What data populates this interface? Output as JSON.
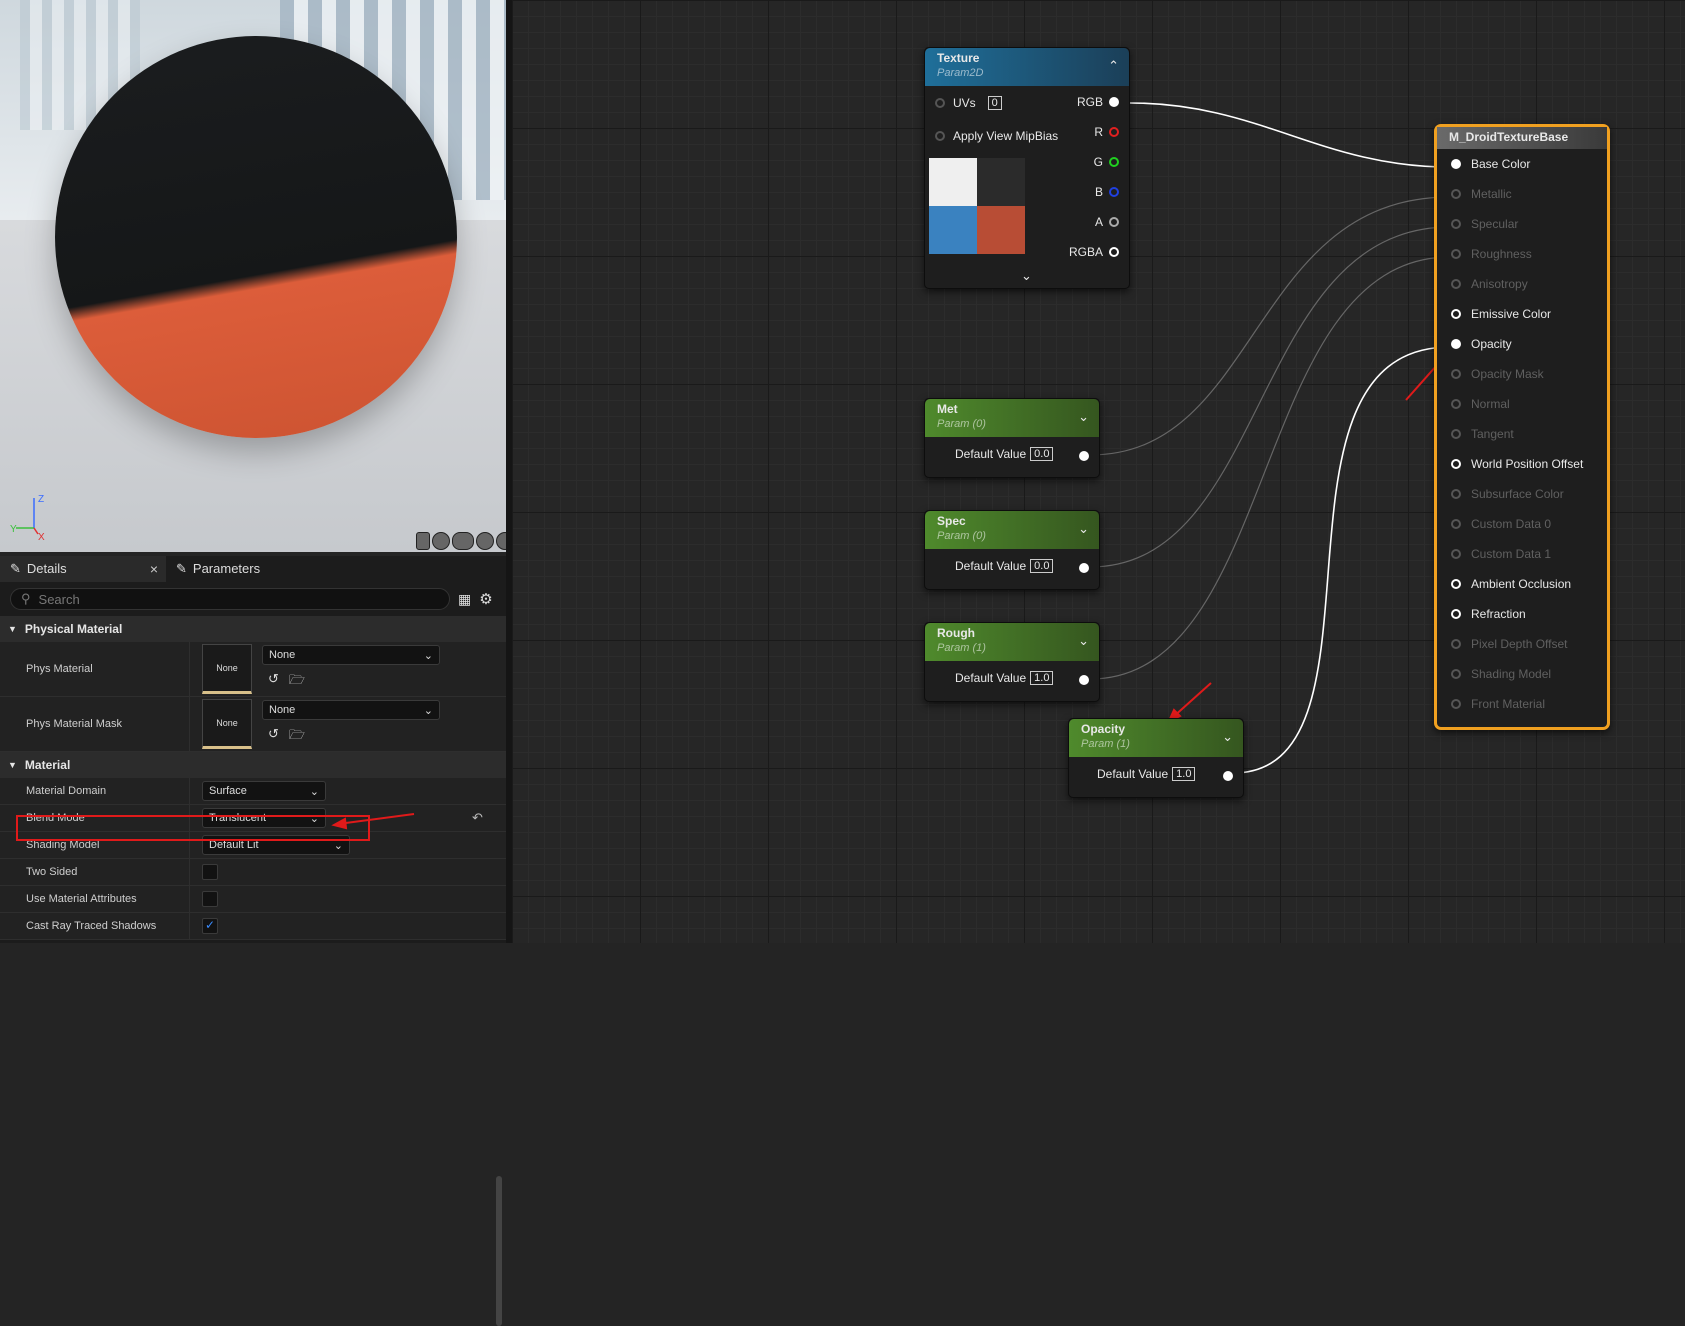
{
  "details_panel": {
    "tabs": [
      {
        "label": "Details",
        "close": "×"
      },
      {
        "label": "Parameters"
      }
    ],
    "search_placeholder": "Search",
    "categories": {
      "physical_material": {
        "title": "Physical Material",
        "rows": [
          {
            "label": "Phys Material",
            "thumb": "None",
            "value": "None"
          },
          {
            "label": "Phys Material Mask",
            "thumb": "None",
            "value": "None"
          }
        ]
      },
      "material": {
        "title": "Material",
        "rows": [
          {
            "label": "Material Domain",
            "value": "Surface"
          },
          {
            "label": "Blend Mode",
            "value": "Translucent"
          },
          {
            "label": "Shading Model",
            "value": "Default Lit"
          },
          {
            "label": "Two Sided",
            "checked": false
          },
          {
            "label": "Use Material Attributes",
            "checked": false
          },
          {
            "label": "Cast Ray Traced Shadows",
            "checked": true
          }
        ]
      }
    }
  },
  "viewport": {
    "axis": {
      "z": "Z",
      "y": "Y",
      "x": "X"
    }
  },
  "nodes": {
    "texture": {
      "title": "Texture",
      "subtitle": "Param2D",
      "inputs": [
        {
          "label": "UVs",
          "value": "0"
        },
        {
          "label": "Apply View MipBias"
        }
      ],
      "outputs": [
        "RGB",
        "R",
        "G",
        "B",
        "A",
        "RGBA"
      ],
      "swatch_colors": [
        "#efefef",
        "#2b2b2b",
        "#3a82c0",
        "#b84d35"
      ]
    },
    "met": {
      "title": "Met",
      "subtitle": "Param (0)",
      "field_label": "Default Value",
      "value": "0.0"
    },
    "spec": {
      "title": "Spec",
      "subtitle": "Param (0)",
      "field_label": "Default Value",
      "value": "0.0"
    },
    "rough": {
      "title": "Rough",
      "subtitle": "Param (1)",
      "field_label": "Default Value",
      "value": "1.0"
    },
    "opacity": {
      "title": "Opacity",
      "subtitle": "Param (1)",
      "field_label": "Default Value",
      "value": "1.0"
    },
    "material_result": {
      "title": "M_DroidTextureBase",
      "pins": [
        {
          "label": "Base Color",
          "state": "connected"
        },
        {
          "label": "Metallic",
          "state": "disabled"
        },
        {
          "label": "Specular",
          "state": "disabled"
        },
        {
          "label": "Roughness",
          "state": "disabled"
        },
        {
          "label": "Anisotropy",
          "state": "disabled"
        },
        {
          "label": "Emissive Color",
          "state": "enabled"
        },
        {
          "label": "Opacity",
          "state": "connected"
        },
        {
          "label": "Opacity Mask",
          "state": "disabled"
        },
        {
          "label": "Normal",
          "state": "disabled"
        },
        {
          "label": "Tangent",
          "state": "disabled"
        },
        {
          "label": "World Position Offset",
          "state": "enabled"
        },
        {
          "label": "Subsurface Color",
          "state": "disabled"
        },
        {
          "label": "Custom Data 0",
          "state": "disabled"
        },
        {
          "label": "Custom Data 1",
          "state": "disabled"
        },
        {
          "label": "Ambient Occlusion",
          "state": "enabled"
        },
        {
          "label": "Refraction",
          "state": "enabled"
        },
        {
          "label": "Pixel Depth Offset",
          "state": "disabled"
        },
        {
          "label": "Shading Model",
          "state": "disabled"
        },
        {
          "label": "Front Material",
          "state": "disabled"
        }
      ]
    }
  },
  "colors": {
    "annotation_red": "#e01a1a",
    "result_node_border": "#f0a020",
    "param_header": "#4f8a2c",
    "texture_header": "#1f6f9a",
    "pin_r": "#e02020",
    "pin_g": "#20d020",
    "pin_b": "#2040e0"
  }
}
